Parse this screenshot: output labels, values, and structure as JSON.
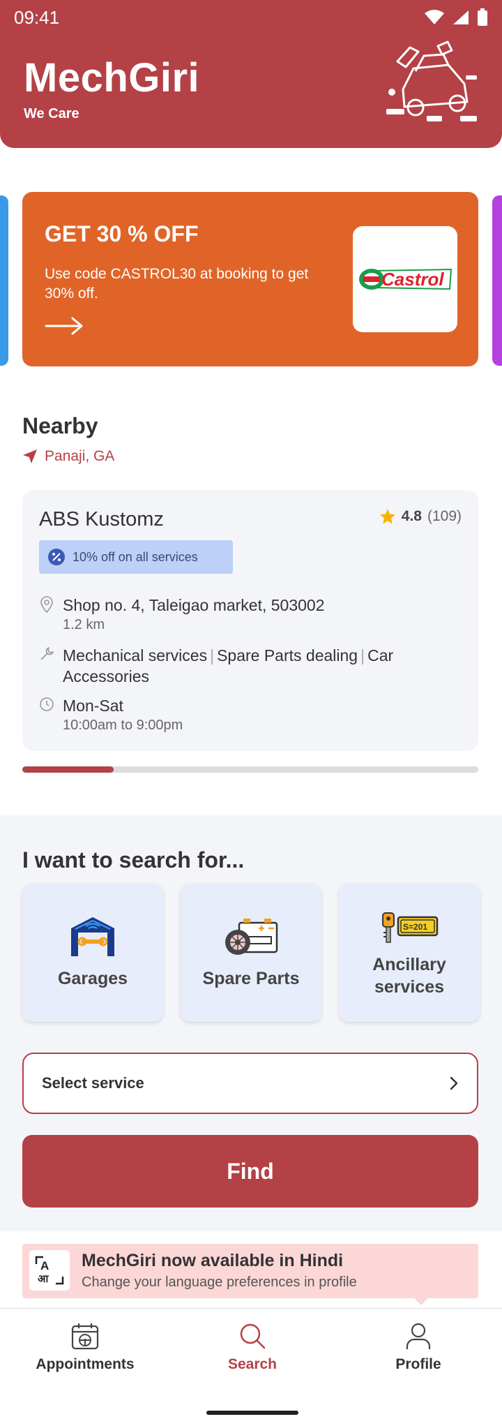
{
  "status_bar": {
    "time": "09:41"
  },
  "header": {
    "brand": "MechGiri",
    "tagline": "We Care"
  },
  "promo": {
    "title": "GET 30 % OFF",
    "description": "Use code CASTROL30 at booking to get 30% off.",
    "logo_text": "Castrol"
  },
  "nearby": {
    "title": "Nearby",
    "location": "Panaji, GA",
    "shop": {
      "name": "ABS Kustomz",
      "rating": "4.8",
      "rating_count": "(109)",
      "offer": "10% off on all services",
      "address": "Shop no. 4, Taleigao market, 503002",
      "distance": "1.2 km",
      "services": [
        "Mechanical services",
        "Spare Parts dealing",
        "Car Accessories"
      ],
      "days": "Mon-Sat",
      "hours": "10:00am to 9:00pm"
    },
    "carousel_progress": 0.2
  },
  "search": {
    "title": "I want to search for...",
    "options": [
      {
        "label": "Garages",
        "icon": "garage-icon"
      },
      {
        "label": "Spare Parts",
        "icon": "spare-parts-icon"
      },
      {
        "label": "Ancillary services",
        "icon": "ancillary-services-icon"
      }
    ],
    "select_placeholder": "Select service",
    "find_label": "Find"
  },
  "language_banner": {
    "title": "MechGiri now available in Hindi",
    "subtitle": "Change your language preferences in profile"
  },
  "bottom_nav": {
    "items": [
      {
        "label": "Appointments",
        "icon": "calendar-car-icon"
      },
      {
        "label": "Search",
        "icon": "search-icon",
        "active": true
      },
      {
        "label": "Profile",
        "icon": "profile-icon"
      }
    ]
  },
  "colors": {
    "brand": "#b44146",
    "promo_bg": "#e06428",
    "offer_bg": "#bcd0f8",
    "banner_bg": "#fcd7d8"
  }
}
